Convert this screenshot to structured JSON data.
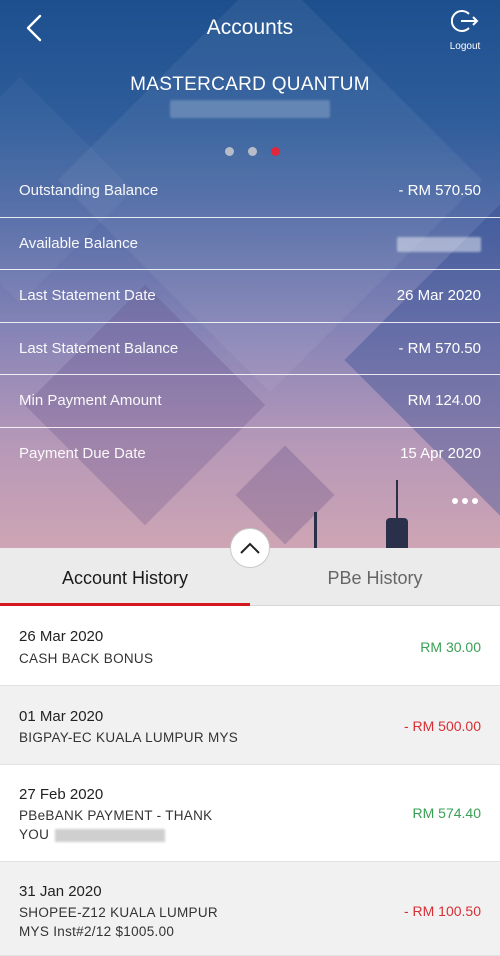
{
  "header": {
    "title": "Accounts",
    "logout_label": "Logout"
  },
  "card": {
    "name": "MASTERCARD QUANTUM",
    "carousel": {
      "total": 3,
      "active_index": 2
    }
  },
  "details": [
    {
      "label": "Outstanding Balance",
      "value": "- RM 570.50"
    },
    {
      "label": "Available Balance",
      "value": ""
    },
    {
      "label": "Last Statement Date",
      "value": "26 Mar 2020"
    },
    {
      "label": "Last Statement Balance",
      "value": "- RM 570.50"
    },
    {
      "label": "Min Payment Amount",
      "value": "RM 124.00"
    },
    {
      "label": "Payment Due Date",
      "value": "15 Apr 2020"
    }
  ],
  "tabs": [
    {
      "label": "Account History",
      "active": true
    },
    {
      "label": "PBe History",
      "active": false
    }
  ],
  "transactions": [
    {
      "date": "26 Mar 2020",
      "description": "CASH BACK BONUS",
      "amount": "RM 30.00",
      "type": "credit"
    },
    {
      "date": "01 Mar 2020",
      "description": "BIGPAY-EC KUALA LUMPUR MYS",
      "amount": "- RM 500.00",
      "type": "debit"
    },
    {
      "date": "27 Feb 2020",
      "description_line1": "PBeBANK PAYMENT - THANK",
      "description_line2": "YOU",
      "amount": "RM 574.40",
      "type": "credit"
    },
    {
      "date": "31 Jan 2020",
      "description_line1": "SHOPEE-Z12 KUALA LUMPUR",
      "description_line2": "MYS Inst#2/12 $1005.00",
      "amount": "- RM 100.50",
      "type": "debit"
    }
  ],
  "colors": {
    "accent": "#d4161d",
    "credit": "#3aa055",
    "debit": "#d62f36"
  },
  "icons": [
    "back-arrow-icon",
    "logout-icon",
    "more-dots-icon",
    "chevron-up-icon"
  ]
}
